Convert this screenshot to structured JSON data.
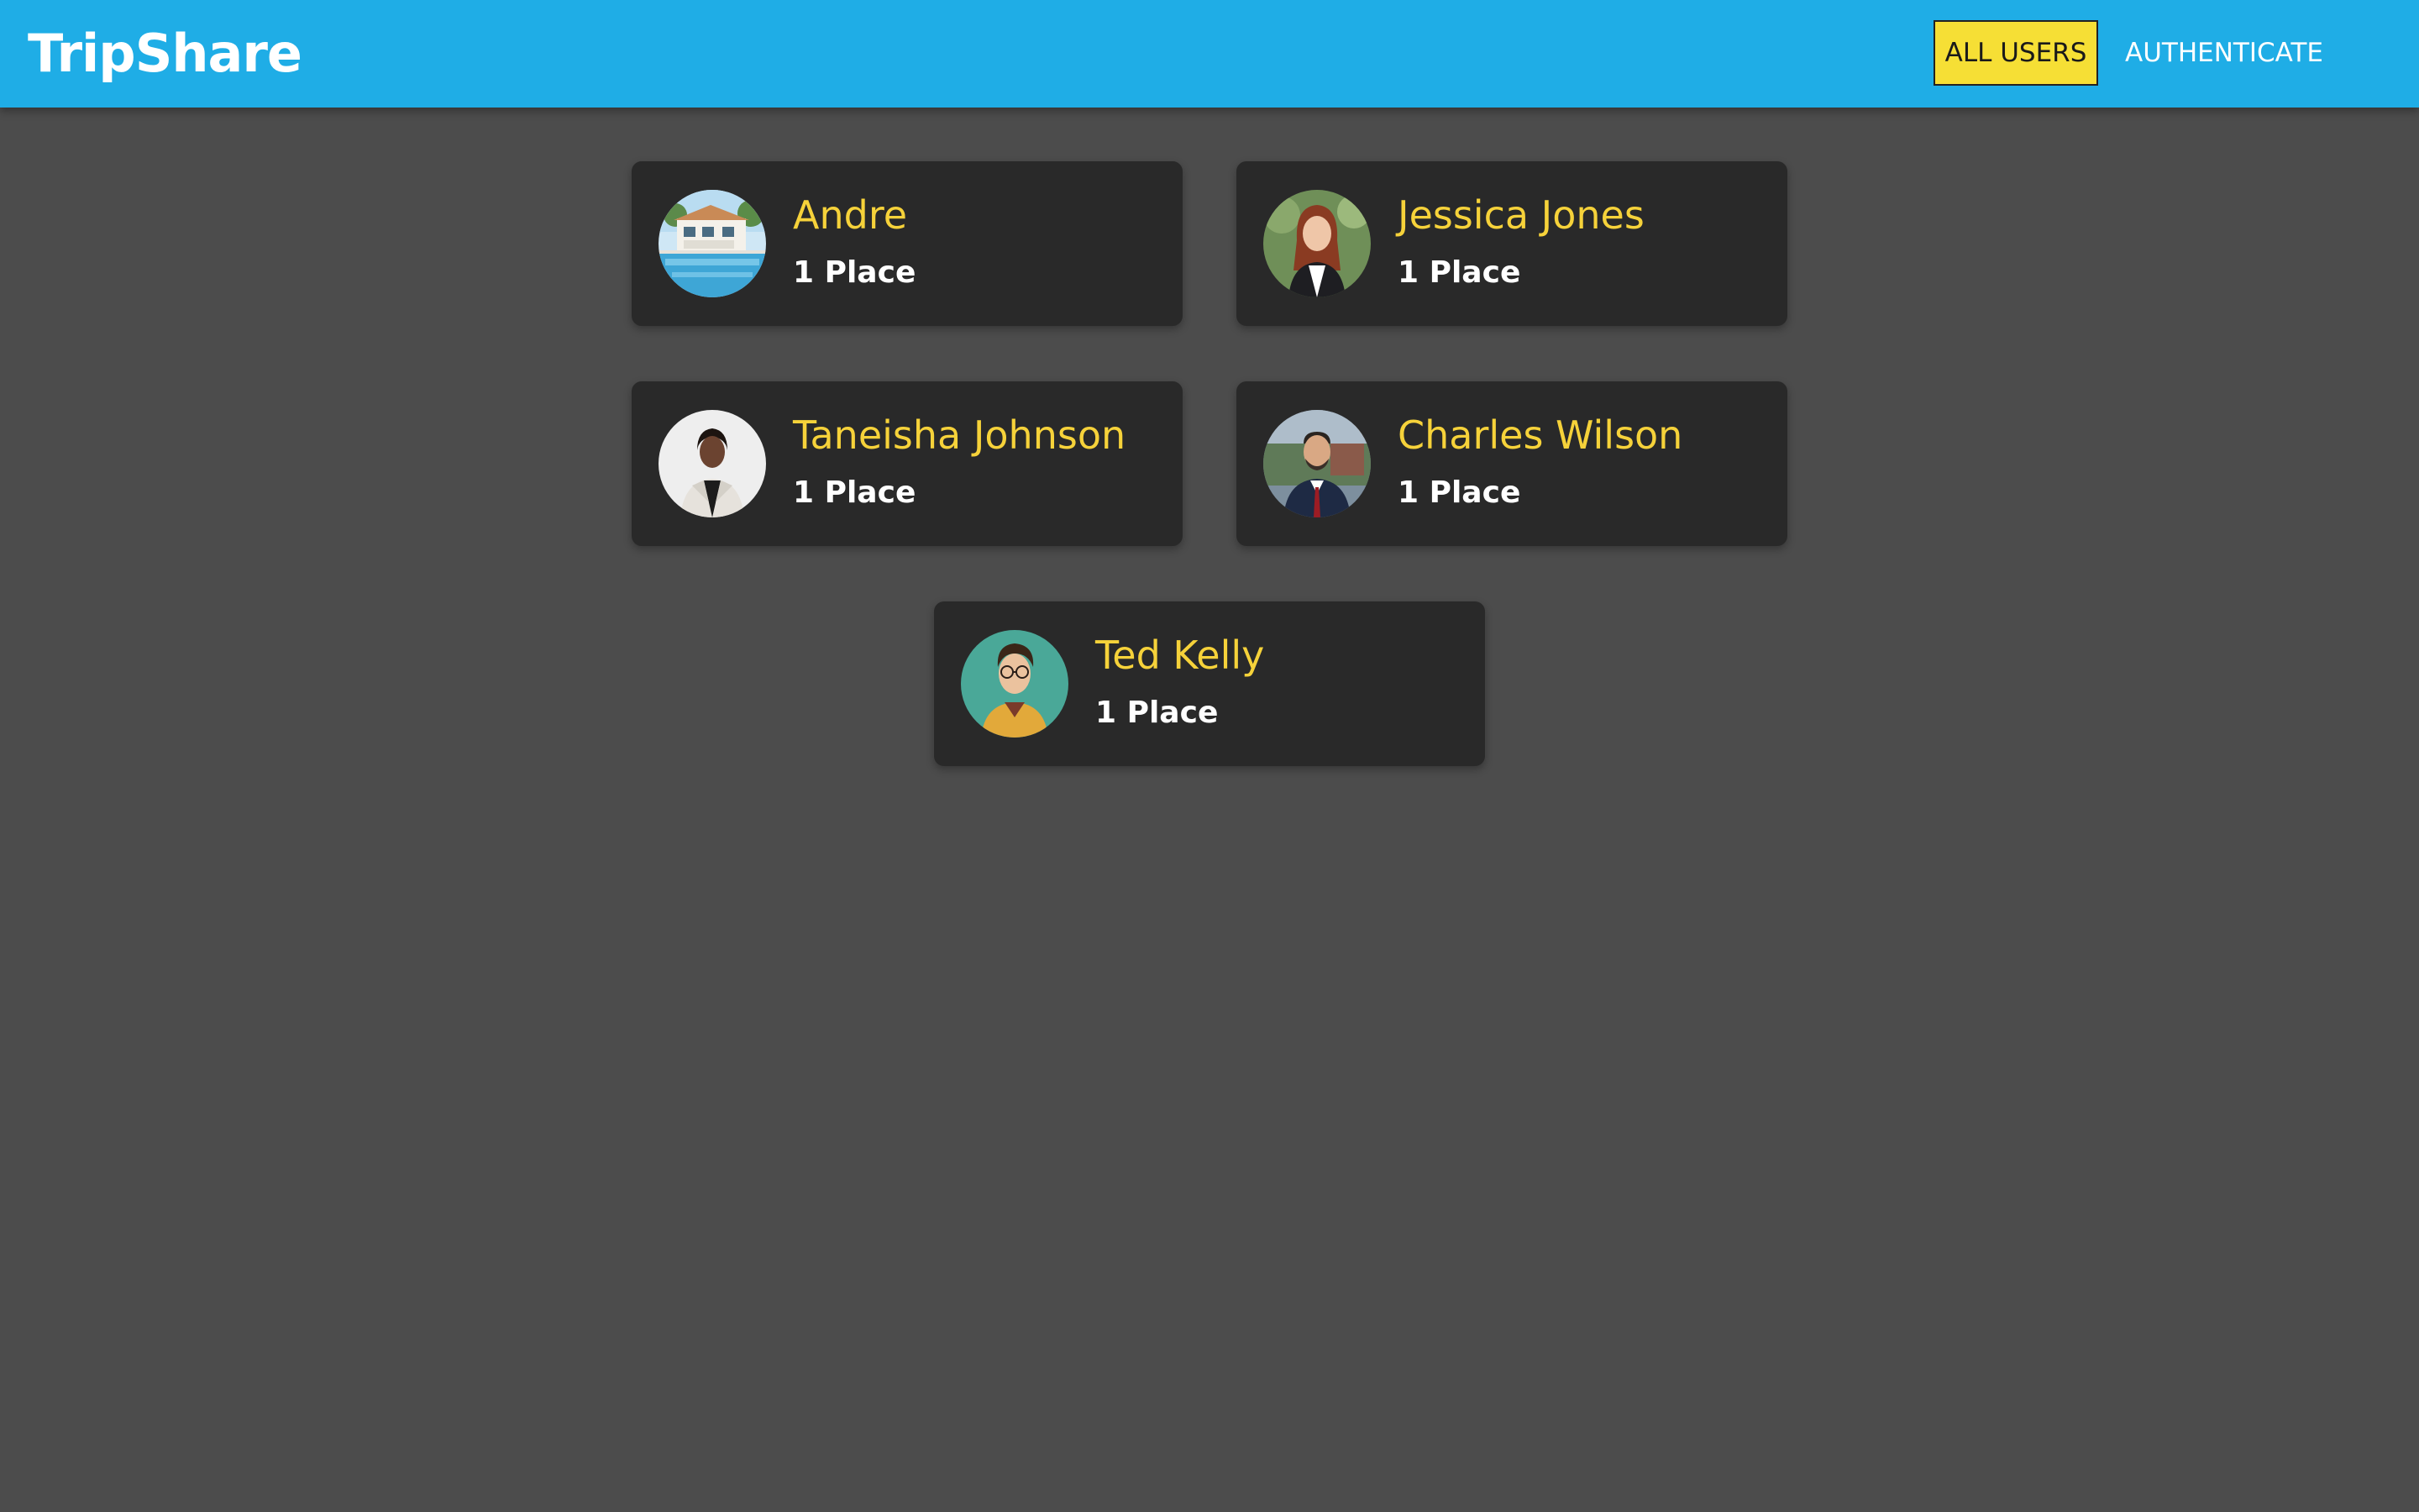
{
  "header": {
    "title": "TripShare",
    "colors": {
      "bar": "#1fade6",
      "active": "#f6df35"
    }
  },
  "nav": {
    "items": [
      {
        "label": "ALL USERS",
        "active": true
      },
      {
        "label": "AUTHENTICATE",
        "active": false
      }
    ]
  },
  "users": [
    {
      "name": "Andre",
      "places": "1 Place",
      "avatar": "house-pool-avatar"
    },
    {
      "name": "Jessica Jones",
      "places": "1 Place",
      "avatar": "woman-portrait-avatar"
    },
    {
      "name": "Taneisha Johnson",
      "places": "1 Place",
      "avatar": "woman-portrait-avatar"
    },
    {
      "name": "Charles Wilson",
      "places": "1 Place",
      "avatar": "man-portrait-avatar"
    },
    {
      "name": "Ted Kelly",
      "places": "1 Place",
      "avatar": "illustrated-man-avatar"
    }
  ],
  "colors": {
    "background": "#4c4c4c",
    "card": "#292929",
    "name": "#f6d23a"
  }
}
